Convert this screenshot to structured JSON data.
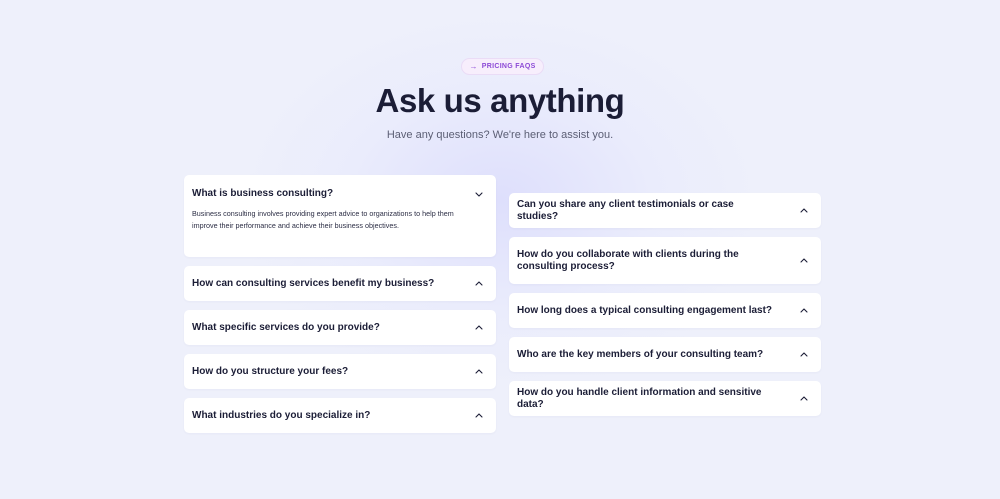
{
  "badge": {
    "icon": "arrow-right-icon",
    "arrow": "→",
    "label": "PRICING FAQS"
  },
  "title": "Ask us anything",
  "subtitle": "Have any questions? We're here to assist you.",
  "colors": {
    "background": "#eef0fb",
    "badge_text": "#8c4ad6",
    "heading": "#1b1d36"
  },
  "faqs_left": [
    {
      "question": "What is business consulting?",
      "expanded": true,
      "answer": "Business consulting involves providing expert advice to organizations to help them improve their performance and achieve their business objectives."
    },
    {
      "question": "How can consulting services benefit my business?",
      "expanded": false
    },
    {
      "question": "What specific services do you provide?",
      "expanded": false
    },
    {
      "question": "How do you structure your fees?",
      "expanded": false
    },
    {
      "question": "What industries do you specialize in?",
      "expanded": false
    }
  ],
  "faqs_right": [
    {
      "question": "Can you share any client testimonials or case studies?",
      "expanded": false
    },
    {
      "question": "How do you collaborate with clients during the consulting process?",
      "expanded": false
    },
    {
      "question": "How long does a typical consulting engagement last?",
      "expanded": false
    },
    {
      "question": "Who are the key members of your consulting team?",
      "expanded": false
    },
    {
      "question": "How do you handle client information and sensitive data?",
      "expanded": false
    }
  ]
}
